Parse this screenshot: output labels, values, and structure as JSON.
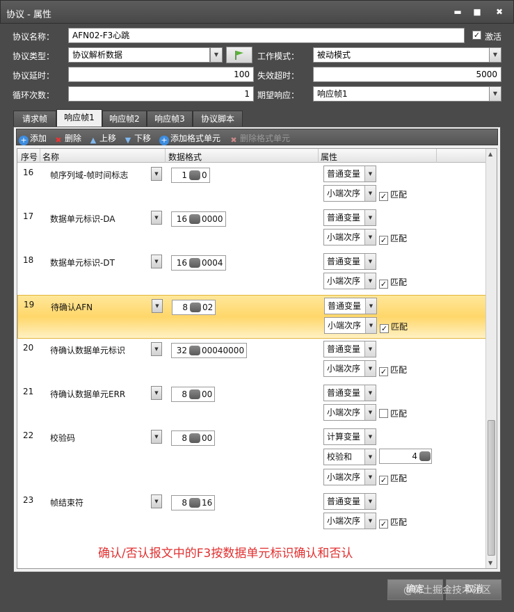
{
  "window": {
    "title": "协议 - 属性",
    "minimize": "▬",
    "maximize": "■",
    "close": "✖"
  },
  "form": {
    "name_label": "协议名称：",
    "name_value": "AFN02-F3心跳",
    "activate_label": "激活",
    "activate_checked": "✓",
    "type_label": "协议类型：",
    "type_value": "协议解析数据",
    "workmode_label": "工作模式：",
    "workmode_value": "被动模式",
    "delay_label": "协议延时：",
    "delay_value": "100",
    "timeout_label": "失效超时：",
    "timeout_value": "5000",
    "loop_label": "循环次数：",
    "loop_value": "1",
    "expect_label": "期望响应：",
    "expect_value": "响应帧1"
  },
  "tabs": [
    "请求帧",
    "响应帧1",
    "响应帧2",
    "响应帧3",
    "协议脚本"
  ],
  "toolbar": {
    "add": "添加",
    "delete": "删除",
    "up": "上移",
    "down": "下移",
    "add_format": "添加格式单元",
    "del_format": "删除格式单元"
  },
  "grid": {
    "headers": [
      "序号",
      "名称",
      "数据格式",
      "属性"
    ],
    "rows": [
      {
        "no": "16",
        "name": "帧序列域-帧时间标志",
        "len": "1",
        "hex": "0",
        "type": "普通变量",
        "order": "小端次序",
        "match": "匹配",
        "checked": "✓"
      },
      {
        "no": "17",
        "name": "数据单元标识-DA",
        "len": "16",
        "hex": "0000",
        "type": "普通变量",
        "order": "小端次序",
        "match": "匹配",
        "checked": "✓"
      },
      {
        "no": "18",
        "name": "数据单元标识-DT",
        "len": "16",
        "hex": "0004",
        "type": "普通变量",
        "order": "小端次序",
        "match": "匹配",
        "checked": "✓"
      },
      {
        "no": "19",
        "name": "待确认AFN",
        "len": "8",
        "hex": "02",
        "type": "普通变量",
        "order": "小端次序",
        "match": "匹配",
        "checked": "✓"
      },
      {
        "no": "20",
        "name": "待确认数据单元标识",
        "len": "32",
        "hex": "00040000",
        "type": "普通变量",
        "order": "小端次序",
        "match": "匹配",
        "checked": "✓"
      },
      {
        "no": "21",
        "name": "待确认数据单元ERR",
        "len": "8",
        "hex": "00",
        "type": "普通变量",
        "order": "小端次序",
        "match": "匹配",
        "checked": ""
      },
      {
        "no": "22",
        "name": "校验码",
        "len": "8",
        "hex": "00",
        "type": "计算变量",
        "checksum": "校验和",
        "checksum_val": "4",
        "order": "小端次序",
        "match": "匹配",
        "checked": "✓"
      },
      {
        "no": "23",
        "name": "帧结束符",
        "len": "8",
        "hex": "16",
        "type": "普通变量",
        "order": "小端次序",
        "match": "匹配",
        "checked": "✓"
      }
    ]
  },
  "note": "确认/否认报文中的F3按数据单元标识确认和否认",
  "buttons": {
    "ok": "确定",
    "cancel": "取消"
  },
  "watermark": "@稀土掘金技术社区"
}
